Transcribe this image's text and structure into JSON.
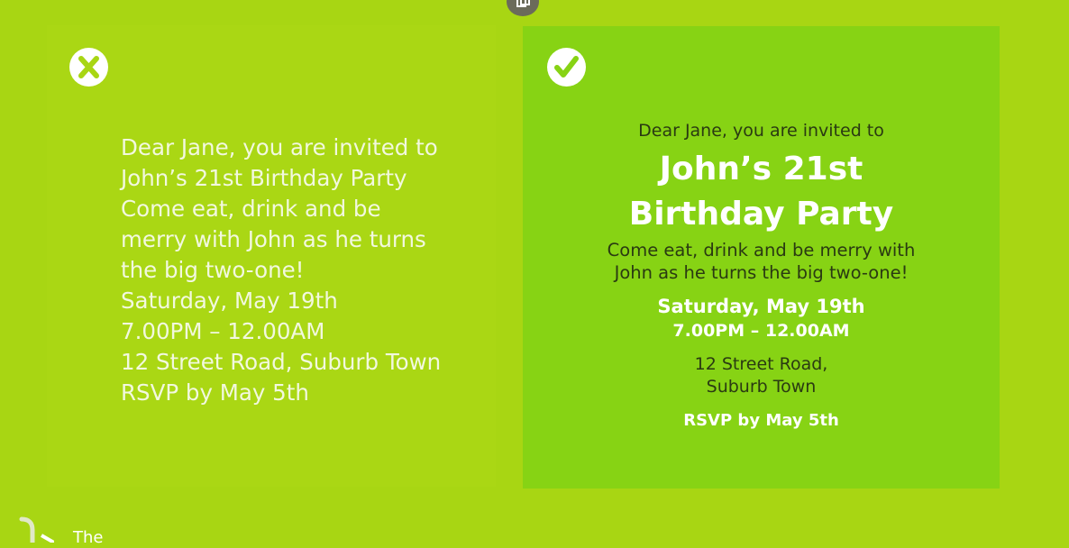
{
  "bad_example": {
    "lines": [
      "Dear Jane, you are invited to",
      "John’s 21st Birthday Party",
      "Come eat, drink and be",
      "merry with John as he turns",
      "the big two-one!",
      "Saturday, May 19th",
      "7.00PM – 12.00AM",
      "12 Street Road, Suburb Town",
      "RSVP by May 5th"
    ]
  },
  "good_example": {
    "invite_line": "Dear Jane, you are invited to",
    "title_line1": "John’s 21st",
    "title_line2": "Birthday Party",
    "body_line1": "Come eat, drink and be merry with",
    "body_line2": "John as he turns the big two-one!",
    "date": "Saturday, May 19th",
    "time": "7.00PM – 12.00AM",
    "address_line1": "12 Street Road,",
    "address_line2": "Suburb Town",
    "rsvp": "RSVP by May 5th"
  },
  "footer": {
    "text": "The"
  },
  "colors": {
    "background": "#a8d613",
    "good_panel": "#87d314",
    "text_light": "#f2f8df",
    "text_dark": "#2a3a12"
  },
  "icons": {
    "bad": "x-icon",
    "good": "checkmark-icon",
    "top": "copy-icon",
    "footer": "logo-icon"
  }
}
